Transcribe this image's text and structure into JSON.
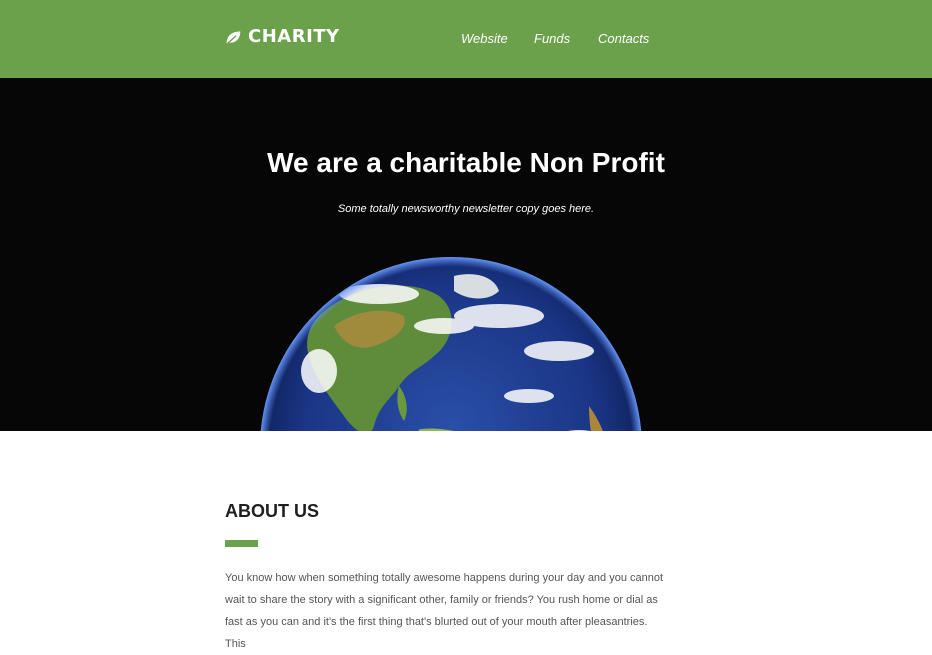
{
  "header": {
    "brand_name": "CHARITY",
    "brand_icon": "leaf-icon",
    "nav": [
      {
        "label": "Website"
      },
      {
        "label": "Funds"
      },
      {
        "label": "Contacts"
      }
    ],
    "background_color": "#6aa14a"
  },
  "hero": {
    "title": "We are a charitable Non Profit",
    "subtitle": "Some totally newsworthy newsletter copy goes here.",
    "image": "earth-globe-image",
    "background_color": "#060606"
  },
  "about": {
    "heading": "ABOUT US",
    "accent_color": "#6aa14a",
    "body": "You know how when something totally awesome happens during your day and you cannot wait to share the story with a significant other, family or friends? You rush home or dial as fast as you can and it's the first thing that's blurted out of your mouth after pleasantries. This"
  }
}
